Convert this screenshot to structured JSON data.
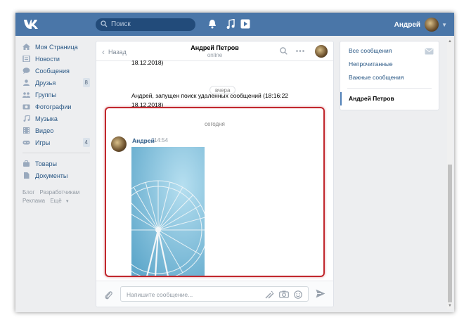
{
  "header": {
    "search_placeholder": "Поиск",
    "user_name": "Андрей"
  },
  "left_nav": {
    "items": [
      {
        "label": "Моя Страница"
      },
      {
        "label": "Новости"
      },
      {
        "label": "Сообщения"
      },
      {
        "label": "Друзья",
        "count": "8"
      },
      {
        "label": "Группы"
      },
      {
        "label": "Фотографии"
      },
      {
        "label": "Музыка"
      },
      {
        "label": "Видео"
      },
      {
        "label": "Игры",
        "count": "4"
      }
    ],
    "extra": [
      {
        "label": "Товары"
      },
      {
        "label": "Документы"
      }
    ],
    "footer": {
      "blog": "Блог",
      "developers": "Разработчикам",
      "ads": "Реклама",
      "more": "Ещё"
    }
  },
  "chat": {
    "back_label": "Назад",
    "peer_name": "Андрей Петров",
    "peer_status": "online",
    "old_message_line1": "18.12.2018)",
    "old_message_line2": "Андрей, запущен поиск удаленных сообщений (18:16:22",
    "old_message_line3": "18.12.2018)",
    "divider_yesterday": "вчера",
    "divider_today": "сегодня",
    "message": {
      "author": "Андрей",
      "time": "14:54"
    },
    "composer_placeholder": "Напишите сообщение..."
  },
  "right_panel": {
    "items": [
      {
        "label": "Все сообщения"
      },
      {
        "label": "Непрочитанные"
      },
      {
        "label": "Важные сообщения"
      }
    ],
    "active_chat": "Андрей Петров"
  },
  "colors": {
    "brand": "#4a76a8",
    "link": "#2a5885",
    "highlight": "#c1272d"
  }
}
